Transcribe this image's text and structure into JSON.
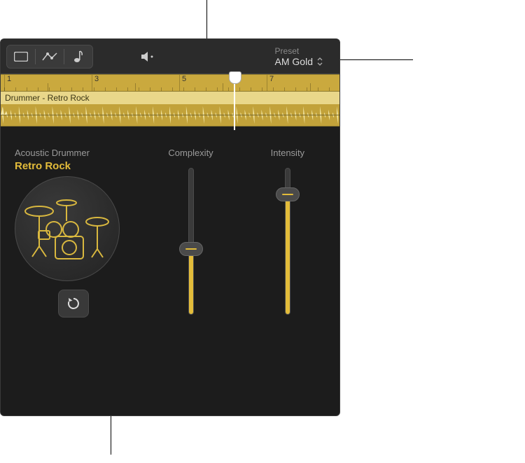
{
  "toolbar": {
    "preset_label": "Preset",
    "preset_value": "AM Gold"
  },
  "ruler": {
    "labels": [
      "1",
      "3",
      "5",
      "7"
    ],
    "positions": [
      5,
      130,
      255,
      380
    ],
    "minors": [
      67,
      192,
      317,
      442
    ]
  },
  "region": {
    "title": "Drummer - Retro Rock"
  },
  "drummer": {
    "category": "Acoustic Drummer",
    "style": "Retro Rock"
  },
  "sliders": {
    "complexity": {
      "label": "Complexity",
      "value": 0.45
    },
    "intensity": {
      "label": "Intensity",
      "value": 0.82
    }
  }
}
